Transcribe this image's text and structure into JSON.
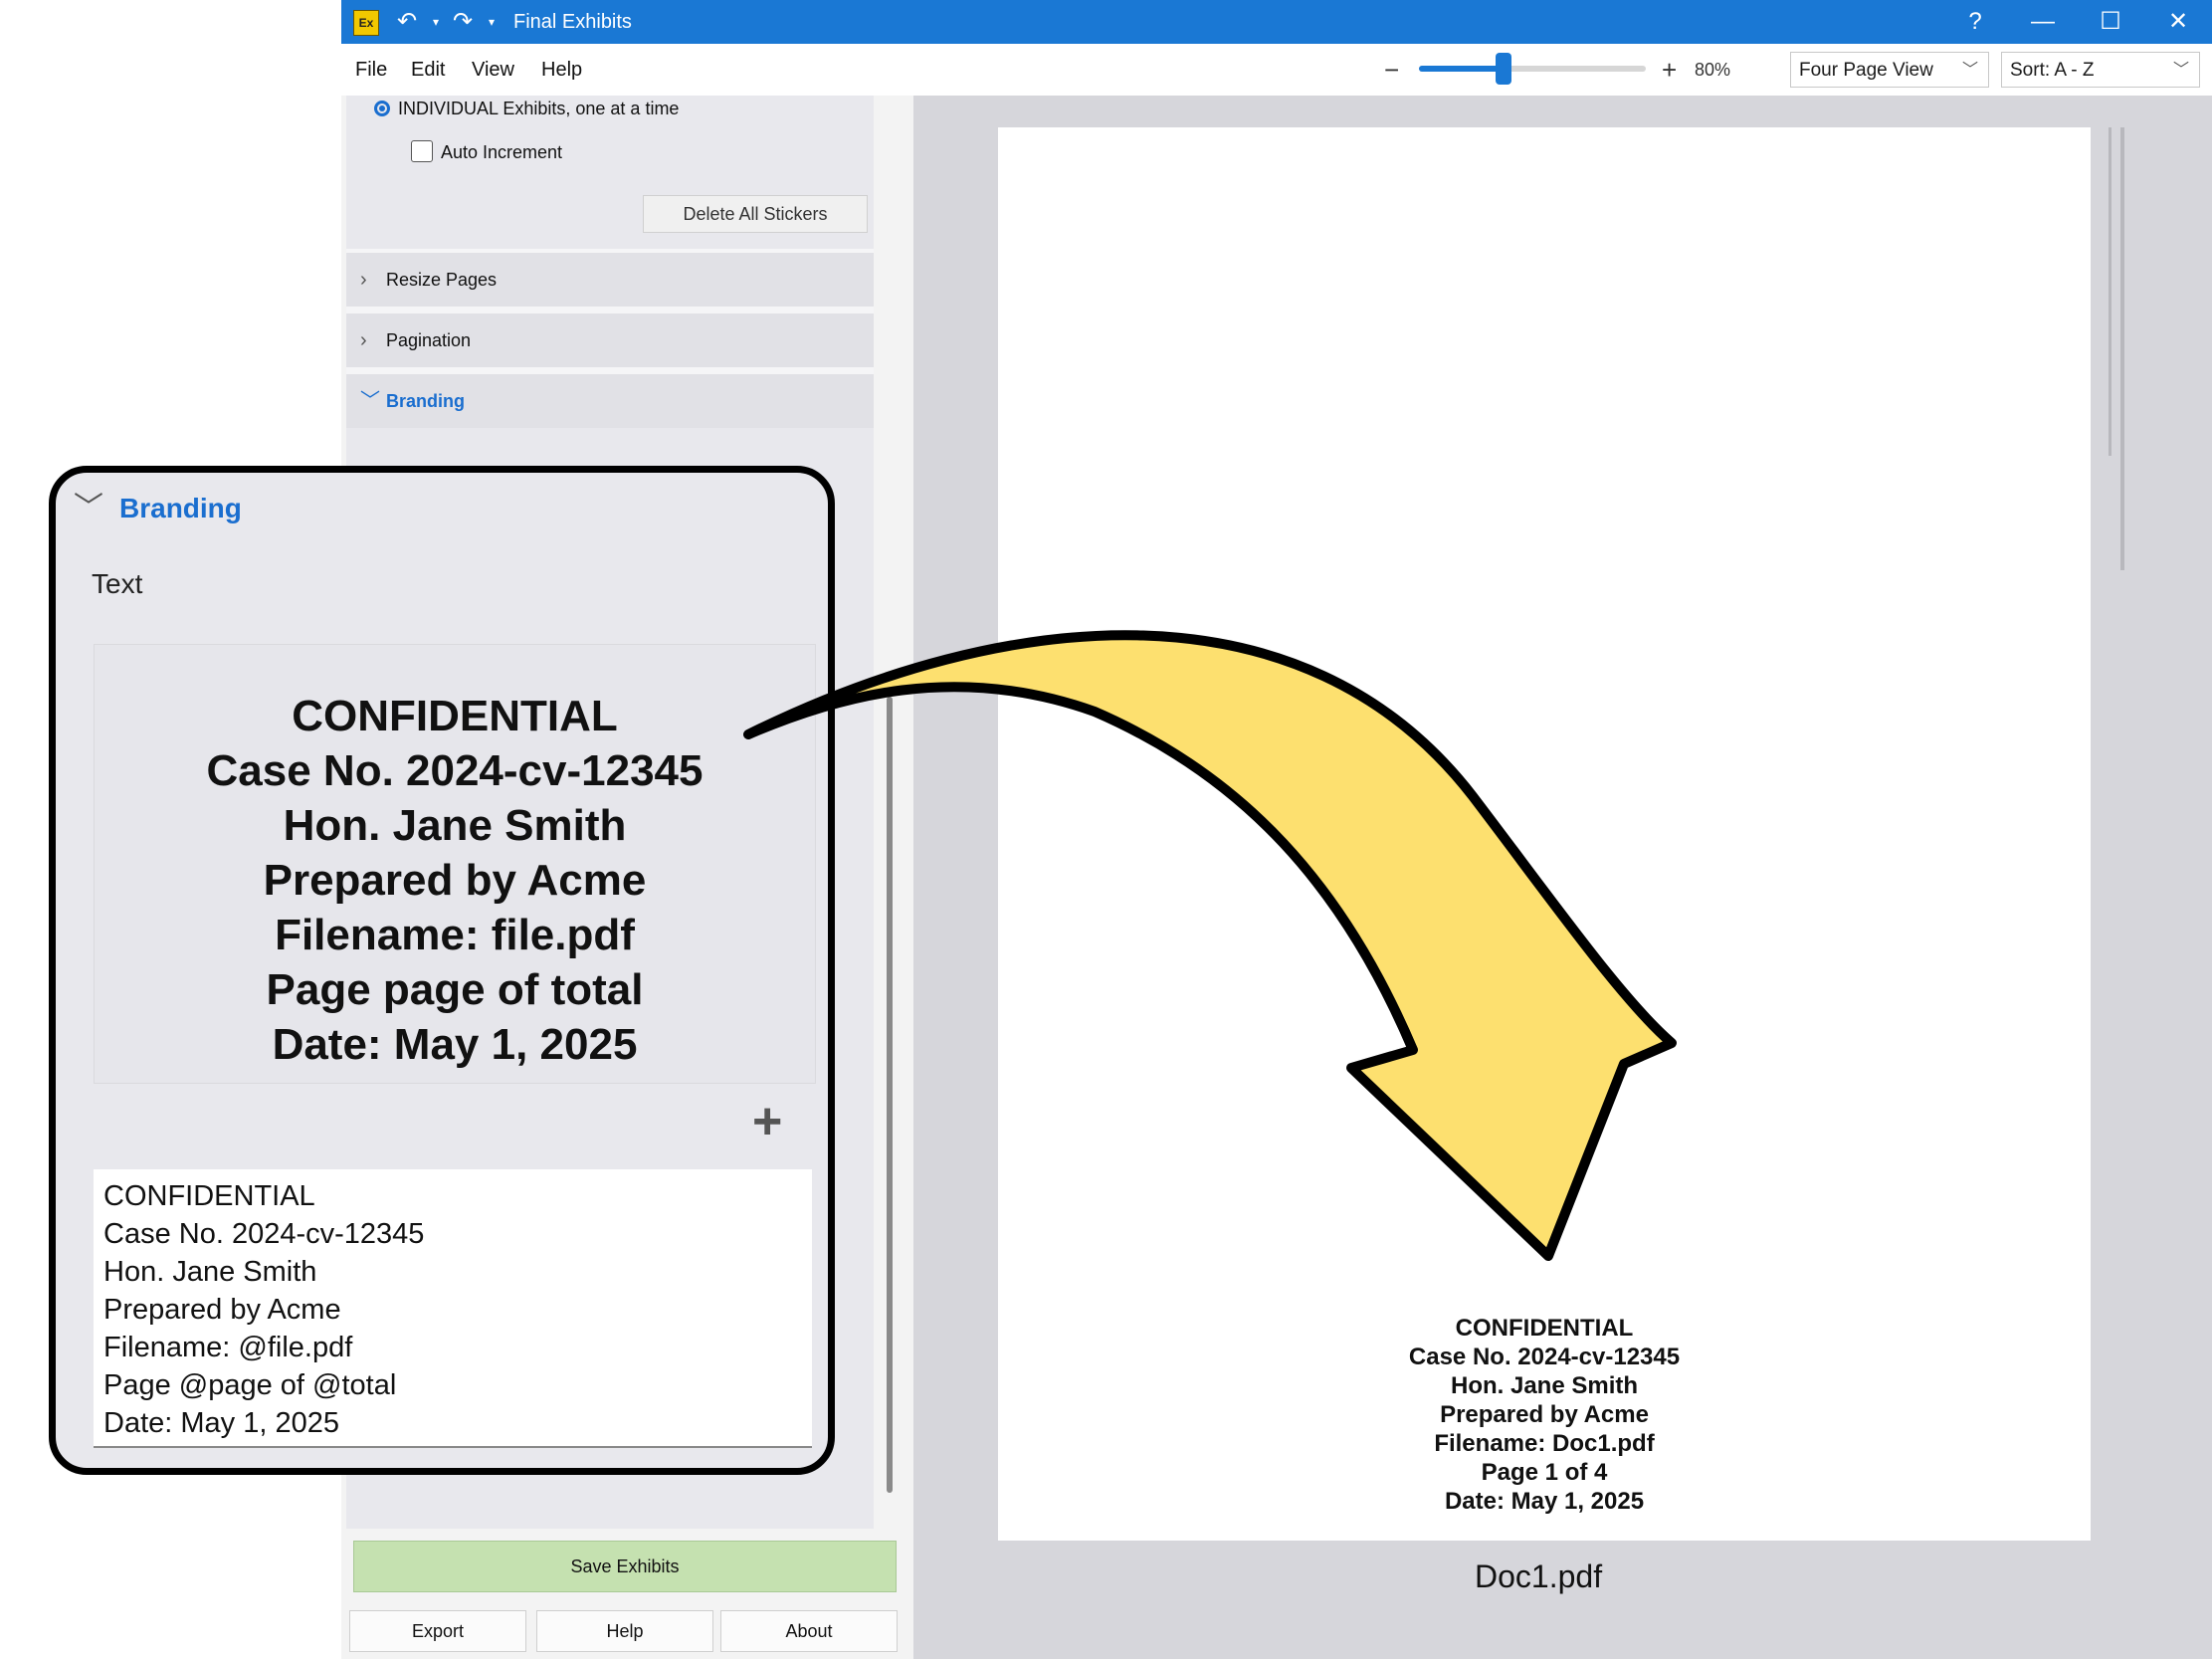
{
  "window": {
    "title": "Final Exhibits",
    "app_icon": "Ex",
    "help_glyph": "?",
    "colors": {
      "titlebar": "#1a78d4",
      "accent": "#1a6ecf",
      "save_button": "#c5e1b0",
      "arrow_fill": "#fde06f"
    }
  },
  "menu": {
    "items": [
      "File",
      "Edit",
      "View",
      "Help"
    ]
  },
  "zoom": {
    "level_text": "80%",
    "level_fraction": 0.4
  },
  "view_select": {
    "value": "Four Page View"
  },
  "sort_select": {
    "value": "Sort: A - Z"
  },
  "sidebar": {
    "radio_label": "INDIVIDUAL Exhibits, one at a time",
    "auto_increment_label": "Auto Increment",
    "delete_button": "Delete All Stickers",
    "sections": [
      "Resize Pages",
      "Pagination",
      "Branding"
    ]
  },
  "callout": {
    "section_title": "Branding",
    "text_label": "Text",
    "preview_lines": [
      "CONFIDENTIAL",
      "Case No. 2024-cv-12345",
      "Hon. Jane Smith",
      "Prepared by Acme",
      "Filename: file.pdf",
      "Page page of total",
      "Date: May 1, 2025"
    ],
    "input_lines": [
      "CONFIDENTIAL",
      "Case No. 2024-cv-12345",
      "Hon. Jane Smith",
      "Prepared by Acme",
      "Filename: @file.pdf",
      "Page @page of @total",
      "Date: May 1, 2025"
    ]
  },
  "preview": {
    "stamp_lines": [
      "CONFIDENTIAL",
      "Case No. 2024-cv-12345",
      "Hon. Jane Smith",
      "Prepared by Acme",
      "Filename: Doc1.pdf",
      "Page 1 of 4",
      "Date: May 1, 2025"
    ],
    "document_name": "Doc1.pdf"
  },
  "actions": {
    "save": "Save Exhibits",
    "export": "Export",
    "help": "Help",
    "about": "About"
  }
}
